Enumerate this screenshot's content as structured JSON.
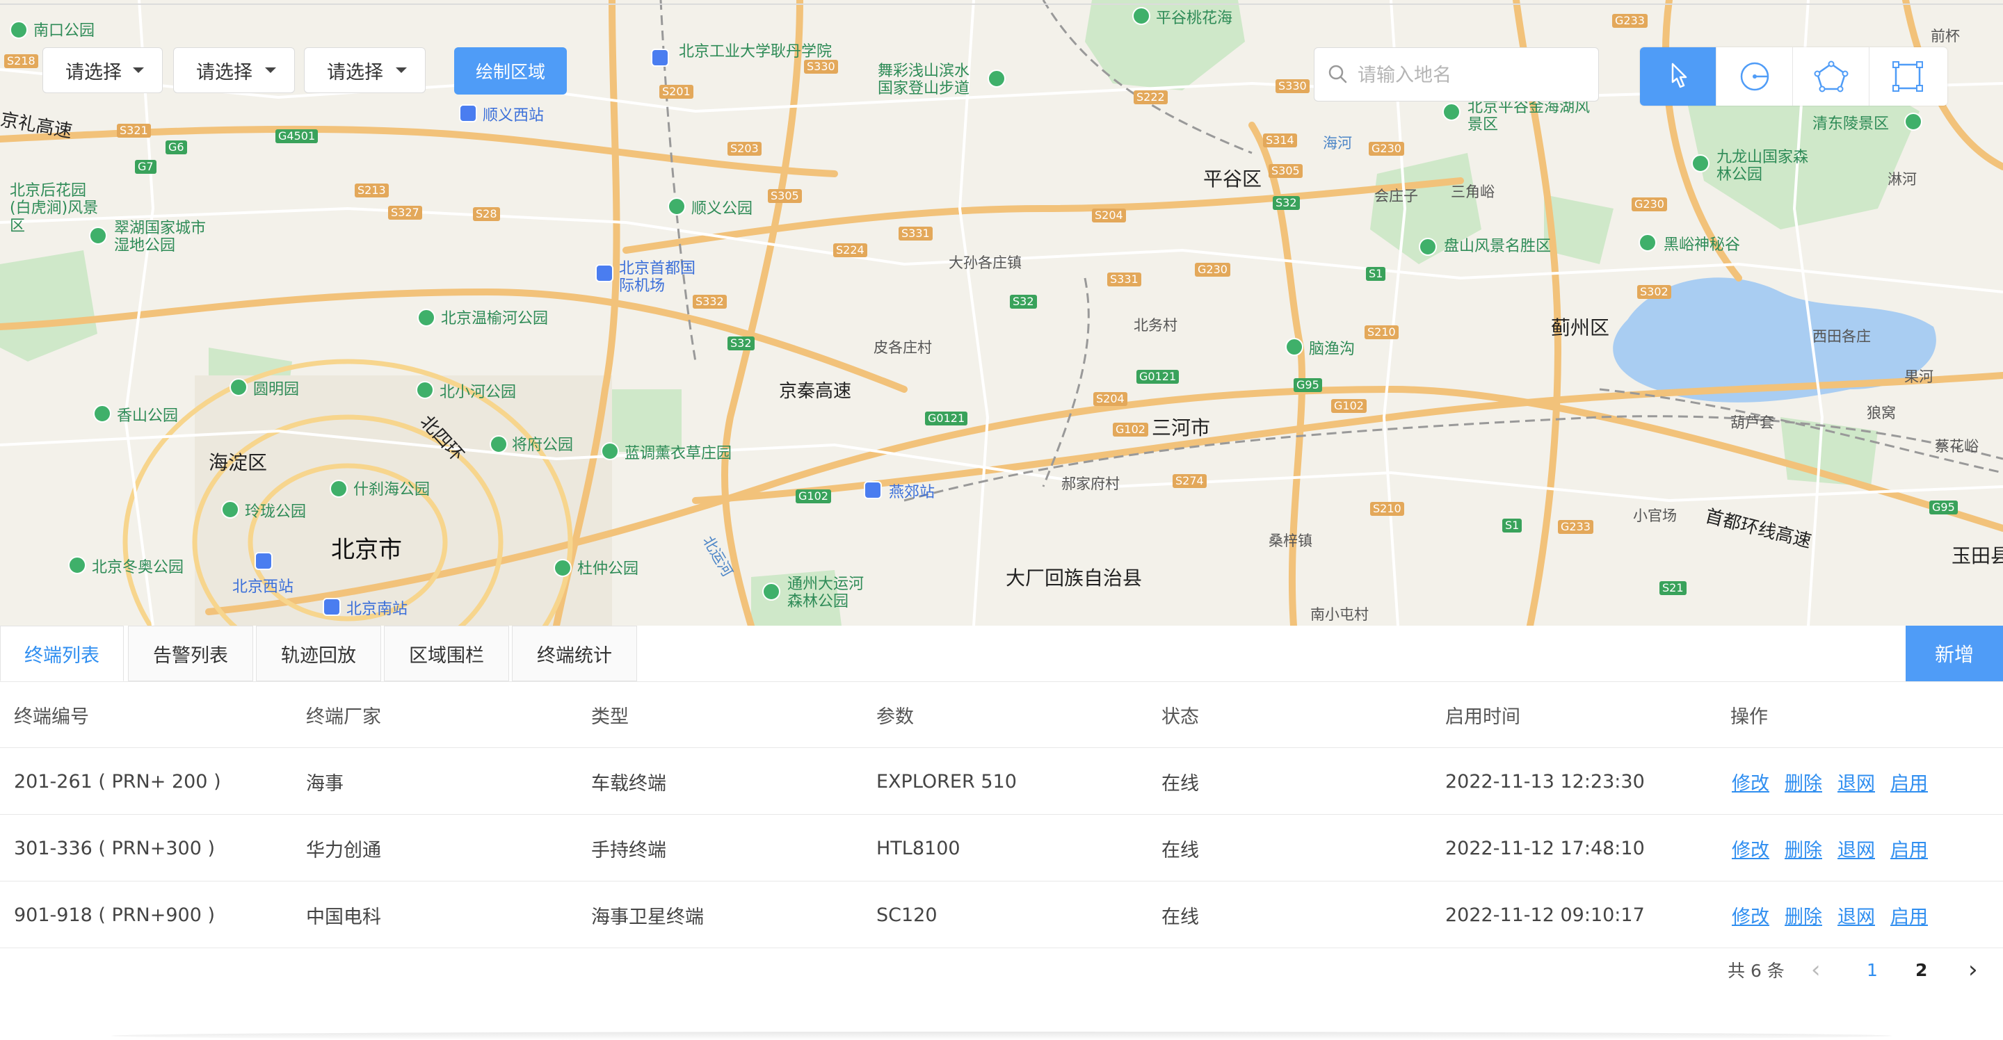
{
  "map": {
    "filters": [
      "请选择",
      "请选择",
      "请选择"
    ],
    "draw_button": "绘制区域",
    "search_placeholder": "请输入地名",
    "tools": [
      "pointer-icon",
      "circle-icon",
      "polygon-icon",
      "rectangle-icon"
    ],
    "labels": {
      "bigcity": [
        "北京市"
      ],
      "city": [
        "平谷区",
        "三河市",
        "蓟州区",
        "海淀区",
        "大厂回族自治县"
      ],
      "highways": [
        "京秦高速",
        "首都环线高速",
        "北四环",
        "京礼高速"
      ],
      "poi": [
        "南口公园",
        "北京工业大学耿丹学院",
        "舞彩浅山滨水国家登山步道",
        "平谷桃花海",
        "北京平谷金海湖风景区",
        "清东陵景区",
        "九龙山国家森林公园",
        "盘山风景名胜区",
        "黑峪神秘谷",
        "北京后花园(白虎涧)风景区",
        "翠湖国家城市湿地公园",
        "顺义西站",
        "顺义公园",
        "北京首都国际机场",
        "北京温榆河公园",
        "圆明园",
        "北小河公园",
        "香山公园",
        "将府公园",
        "蓝调薰衣草庄园",
        "什刹海公园",
        "玲珑公园",
        "北京冬奥公园",
        "北京西站",
        "北京南站",
        "杜仲公园",
        "通州大运河森林公园",
        "燕郊站",
        "脑渔沟",
        "大孙各庄镇",
        "皮各庄村",
        "北务村",
        "会庄子",
        "三角峪",
        "西田各庄",
        "果河",
        "葫芦套",
        "狼窝",
        "蔡花峪",
        "郝家府村",
        "桑梓镇",
        "南小屯村",
        "小官场",
        "玉田县",
        "前杯",
        "淋河",
        "海河",
        "北运河"
      ],
      "roads": [
        "S218",
        "G6",
        "G7",
        "S321",
        "G4501",
        "S213",
        "S327",
        "S28",
        "S201",
        "S330",
        "S203",
        "S305",
        "S331",
        "S224",
        "S332",
        "S32",
        "S222",
        "S314",
        "S305",
        "S204",
        "S330",
        "G230",
        "S32",
        "G230",
        "S1",
        "S331",
        "S32",
        "G0121",
        "G95",
        "S210",
        "G102",
        "S204",
        "G0121",
        "S274",
        "G102",
        "G102",
        "S210",
        "S1",
        "G233",
        "G230",
        "S302",
        "G95",
        "S21",
        "G233"
      ]
    }
  },
  "tabs": [
    "终端列表",
    "告警列表",
    "轨迹回放",
    "区域围栏",
    "终端统计"
  ],
  "add_button": "新增",
  "table": {
    "headers": [
      "终端编号",
      "终端厂家",
      "类型",
      "参数",
      "状态",
      "启用时间",
      "操作"
    ],
    "rows": [
      {
        "id": "201-261 ( PRN+ 200 )",
        "vendor": "海事",
        "type": "车载终端",
        "param": "EXPLORER 510",
        "status": "在线",
        "time": "2022-11-13 12:23:30"
      },
      {
        "id": "301-336 ( PRN+300 )",
        "vendor": "华力创通",
        "type": "手持终端",
        "param": "HTL8100",
        "status": "在线",
        "time": "2022-11-12 17:48:10"
      },
      {
        "id": "901-918 ( PRN+900 )",
        "vendor": "中国电科",
        "type": "海事卫星终端",
        "param": "SC120",
        "status": "在线",
        "time": "2022-11-12 09:10:17"
      }
    ],
    "actions": [
      "修改",
      "删除",
      "退网",
      "启用"
    ]
  },
  "pagination": {
    "total": "共 6 条",
    "prev": "‹",
    "pages": [
      "1",
      "2"
    ],
    "next": "›"
  },
  "colors": {
    "accent": "#4f9cf7",
    "link": "#2f8ef0"
  }
}
